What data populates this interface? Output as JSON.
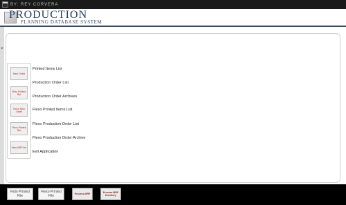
{
  "window": {
    "title": "BY:  REY CORVERA",
    "icon": "app-window-icon"
  },
  "header": {
    "logo_title": "PRODUCTION",
    "logo_subtitle": "PLANNING DATABASE SYSTEM",
    "accent_color": "#1f3f63"
  },
  "menu": {
    "items": [
      {
        "button_label": "New Order",
        "label": "Printed Items List"
      },
      {
        "button_label": "",
        "label": "Production Order List"
      },
      {
        "button_label": "Roto Printed Rpt",
        "label": "Production Order Archives"
      },
      {
        "button_label": "Flexo New Order",
        "label": "Flexo Printed Items List"
      },
      {
        "button_label": "Flexo Printed Rpt",
        "label": "Flexo Production Order List"
      },
      {
        "button_label": "",
        "label": "Flexo Production Order Archive"
      },
      {
        "button_label": "New MRP list",
        "label": "Exit Application"
      }
    ]
  },
  "footer": {
    "buttons": [
      {
        "label": "Roto Printed File"
      },
      {
        "label": "Flexo Printed File"
      },
      {
        "label": "Process MRP"
      },
      {
        "label": "Process MRP Inventory"
      }
    ]
  }
}
